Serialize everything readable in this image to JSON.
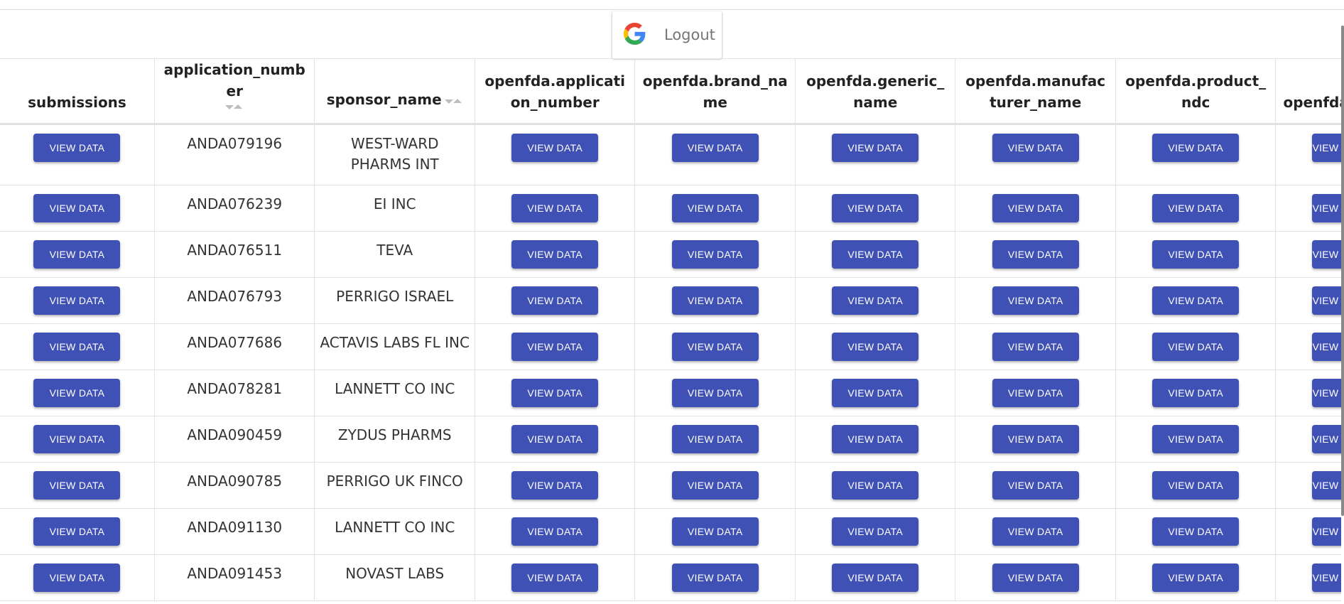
{
  "auth": {
    "logout_label": "Logout"
  },
  "table": {
    "headers": [
      "submissions",
      "application_number",
      "sponsor_name",
      "openfda.application_number",
      "openfda.brand_name",
      "openfda.generic_name",
      "openfda.manufacturer_name",
      "openfda.product_ndc",
      "openfda"
    ],
    "button_label": "VIEW DATA",
    "rows": [
      {
        "application_number": "ANDA079196",
        "sponsor_name": "WEST-WARD PHARMS INT"
      },
      {
        "application_number": "ANDA076239",
        "sponsor_name": "EI INC"
      },
      {
        "application_number": "ANDA076511",
        "sponsor_name": "TEVA"
      },
      {
        "application_number": "ANDA076793",
        "sponsor_name": "PERRIGO ISRAEL"
      },
      {
        "application_number": "ANDA077686",
        "sponsor_name": "ACTAVIS LABS FL INC"
      },
      {
        "application_number": "ANDA078281",
        "sponsor_name": "LANNETT CO INC"
      },
      {
        "application_number": "ANDA090459",
        "sponsor_name": "ZYDUS PHARMS"
      },
      {
        "application_number": "ANDA090785",
        "sponsor_name": "PERRIGO UK FINCO"
      },
      {
        "application_number": "ANDA091130",
        "sponsor_name": "LANNETT CO INC"
      },
      {
        "application_number": "ANDA091453",
        "sponsor_name": "NOVAST LABS"
      }
    ]
  },
  "colors": {
    "button_bg": "#3f51b5",
    "button_text": "#ffffff"
  },
  "icons": {
    "login_provider": "google-icon",
    "sort": "sort-arrows-icon"
  }
}
